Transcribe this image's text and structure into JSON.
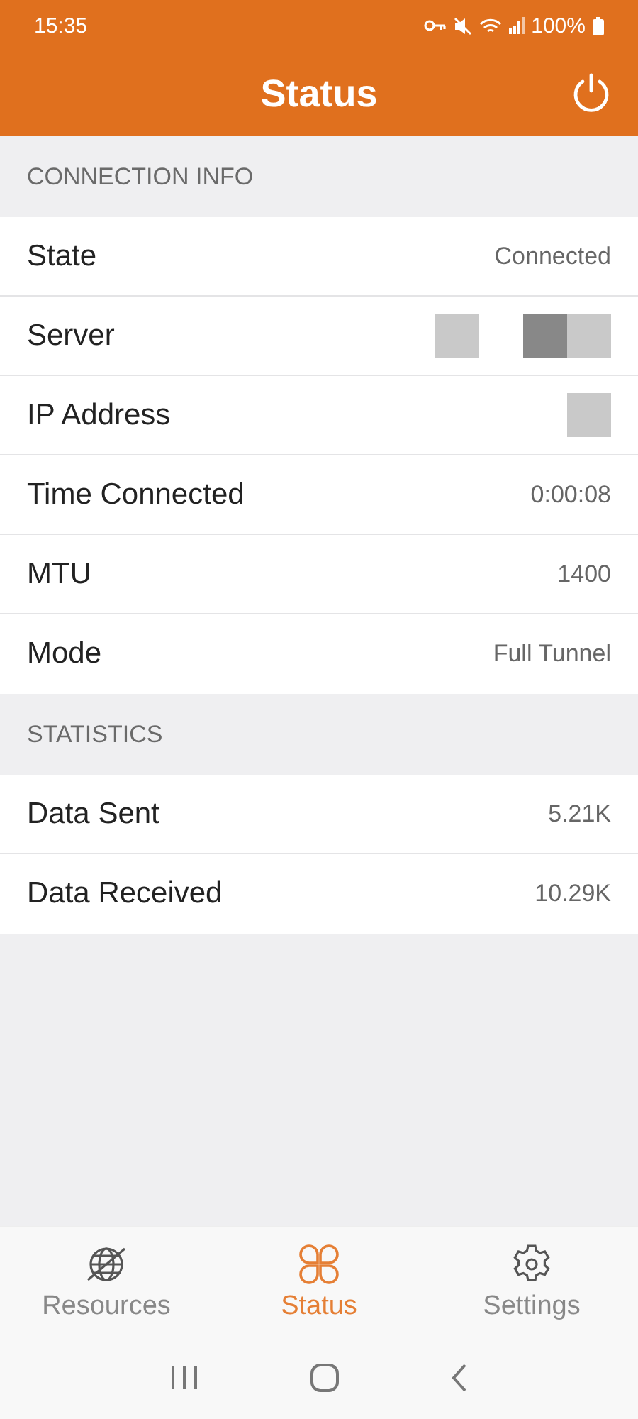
{
  "status_bar": {
    "time": "15:35",
    "battery": "100%"
  },
  "app_bar": {
    "title": "Status"
  },
  "sections": [
    {
      "title": "CONNECTION INFO",
      "rows": [
        {
          "label": "State",
          "kind": "text",
          "value": "Connected"
        },
        {
          "label": "Server",
          "kind": "masked"
        },
        {
          "label": "IP Address",
          "kind": "patch"
        },
        {
          "label": "Time Connected",
          "kind": "text",
          "value": "0:00:08"
        },
        {
          "label": "MTU",
          "kind": "text",
          "value": "1400"
        },
        {
          "label": "Mode",
          "kind": "text",
          "value": "Full Tunnel"
        }
      ]
    },
    {
      "title": "STATISTICS",
      "rows": [
        {
          "label": "Data Sent",
          "kind": "text",
          "value": "5.21K"
        },
        {
          "label": "Data Received",
          "kind": "text",
          "value": "10.29K"
        }
      ]
    }
  ],
  "tabs": [
    {
      "label": "Resources",
      "kind": "globe",
      "selected": false
    },
    {
      "label": "Status",
      "kind": "clover",
      "selected": true
    },
    {
      "label": "Settings",
      "kind": "gear",
      "selected": false
    }
  ]
}
